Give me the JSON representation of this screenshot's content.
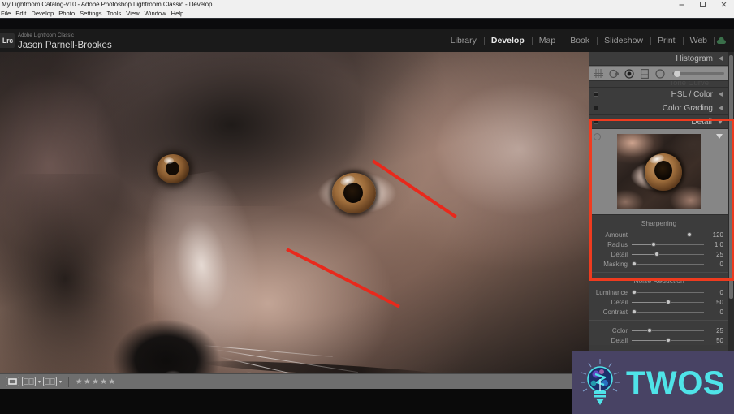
{
  "window": {
    "title": "My Lightroom Catalog-v10 - Adobe Photoshop Lightroom Classic - Develop",
    "minimize_label": "minimize",
    "maximize_label": "restore",
    "close_label": "close"
  },
  "menubar": {
    "items": [
      {
        "label": "File"
      },
      {
        "label": "Edit"
      },
      {
        "label": "Develop"
      },
      {
        "label": "Photo"
      },
      {
        "label": "Settings"
      },
      {
        "label": "Tools"
      },
      {
        "label": "View"
      },
      {
        "label": "Window"
      },
      {
        "label": "Help"
      }
    ]
  },
  "identity": {
    "logo_text": "Lrc",
    "app_name": "Adobe Lightroom Classic",
    "user_name": "Jason Parnell-Brookes"
  },
  "modules": {
    "items": [
      {
        "label": "Library",
        "active": false
      },
      {
        "label": "Develop",
        "active": true
      },
      {
        "label": "Map",
        "active": false
      },
      {
        "label": "Book",
        "active": false
      },
      {
        "label": "Slideshow",
        "active": false
      },
      {
        "label": "Print",
        "active": false
      },
      {
        "label": "Web",
        "active": false
      }
    ]
  },
  "right_panel": {
    "histogram": {
      "title": "Histogram"
    },
    "tone_curve": {
      "title": "Tone Curve"
    },
    "hsl_color": {
      "title": "HSL / Color"
    },
    "color_grading": {
      "title": "Color Grading"
    },
    "detail": {
      "title": "Detail",
      "sharpening": {
        "title": "Sharpening",
        "sliders": [
          {
            "label": "Amount",
            "value": "120",
            "pos": 80
          },
          {
            "label": "Radius",
            "value": "1.0",
            "pos": 30
          },
          {
            "label": "Detail",
            "value": "25",
            "pos": 35
          },
          {
            "label": "Masking",
            "value": "0",
            "pos": 3
          }
        ]
      },
      "noise_reduction": {
        "title": "Noise Reduction",
        "sliders": [
          {
            "label": "Luminance",
            "value": "0",
            "pos": 3
          },
          {
            "label": "Detail",
            "value": "50",
            "pos": 50
          },
          {
            "label": "Contrast",
            "value": "0",
            "pos": 3
          }
        ],
        "color_sliders": [
          {
            "label": "Color",
            "value": "25",
            "pos": 25
          },
          {
            "label": "Detail",
            "value": "50",
            "pos": 50
          }
        ]
      }
    },
    "tools": [
      {
        "name": "crop-overlay-icon"
      },
      {
        "name": "spot-removal-icon"
      },
      {
        "name": "masking-icon"
      },
      {
        "name": "graduated-filter-icon"
      },
      {
        "name": "radial-filter-icon"
      }
    ]
  },
  "toolbar": {
    "view_loupe_label": "Loupe view",
    "view_compare_label": "Compare view",
    "view_survey_label": "Survey view",
    "rating": "★★★★★"
  },
  "watermark": {
    "text": "TWOS",
    "bulb_label": "lightbulb-logo"
  },
  "colors": {
    "annotation_red": "#e8291c",
    "highlight_red": "#ef3b1f",
    "watermark_cyan": "#4fe3e8",
    "watermark_bg": "#484364",
    "panel_bg": "#3a3a3a"
  }
}
